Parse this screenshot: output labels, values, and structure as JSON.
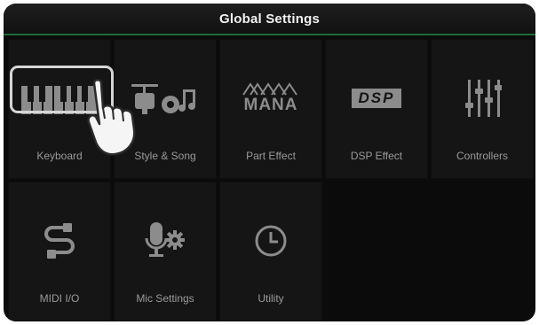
{
  "header": {
    "title": "Global Settings"
  },
  "tiles": [
    {
      "label": "Keyboard",
      "icon": "keyboard-icon"
    },
    {
      "label": "Style & Song",
      "icon": "drum-kit-icon"
    },
    {
      "label": "Part Effect",
      "icon": "mana-logo-icon",
      "icon_text": "MANA"
    },
    {
      "label": "DSP Effect",
      "icon": "dsp-logo-icon",
      "icon_text": "DSP"
    },
    {
      "label": "Controllers",
      "icon": "sliders-icon"
    },
    {
      "label": "MIDI I/O",
      "icon": "midi-cable-icon"
    },
    {
      "label": "Mic Settings",
      "icon": "microphone-gear-icon"
    },
    {
      "label": "Utility",
      "icon": "clock-icon"
    }
  ],
  "selected_tile": "Keyboard",
  "colors": {
    "accent": "#1d6b3a",
    "icon": "#8c8c8c",
    "label": "#9a9a9a",
    "tile": "#151515"
  }
}
